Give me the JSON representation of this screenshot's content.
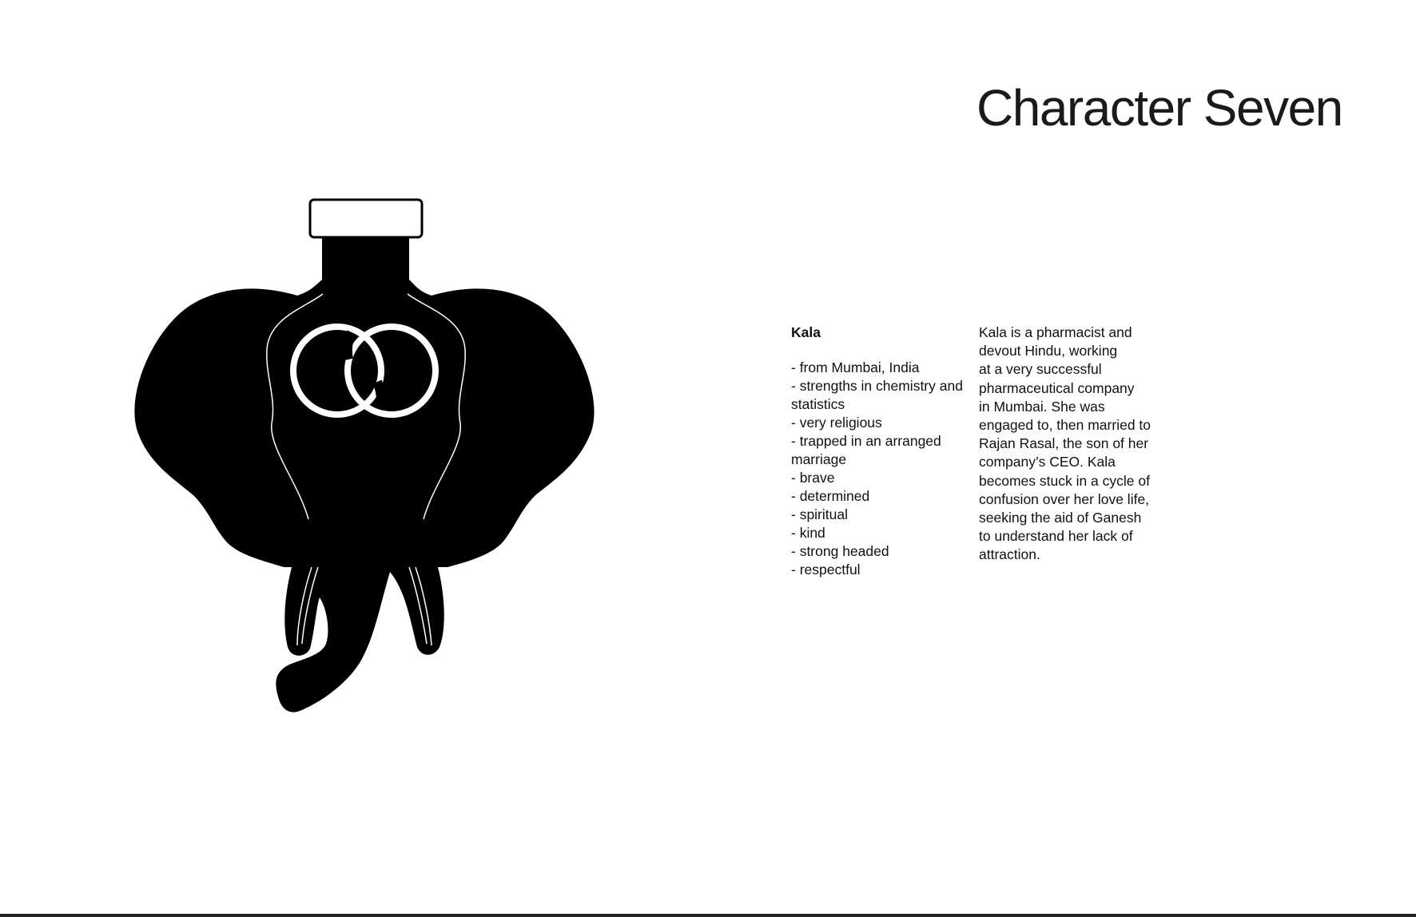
{
  "page": {
    "title": "Character Seven"
  },
  "character": {
    "name": "Kala",
    "traits": [
      "- from Mumbai, India",
      "- strengths in chemistry and statistics",
      "- very religious",
      "- trapped in an arranged marriage",
      "- brave",
      "- determined",
      "- spiritual",
      "- kind",
      "- strong headed",
      "- respectful"
    ],
    "bio_lines": [
      "Kala is a pharmacist and",
      "devout Hindu, working",
      "at a very successful",
      "pharmaceutical company",
      "in Mumbai. She was",
      "engaged to, then married to",
      "Rajan Rasal, the son of her",
      "company’s CEO. Kala",
      "becomes stuck in a cycle of",
      "confusion over her love life,",
      "seeking the aid of Ganesh",
      "to understand her lack of",
      "attraction."
    ]
  },
  "illustration": {
    "icon": "elephant-bottle-icon",
    "motif": "interlocked-rings-icon",
    "fill_color": "#000000",
    "line_color": "#ffffff"
  }
}
